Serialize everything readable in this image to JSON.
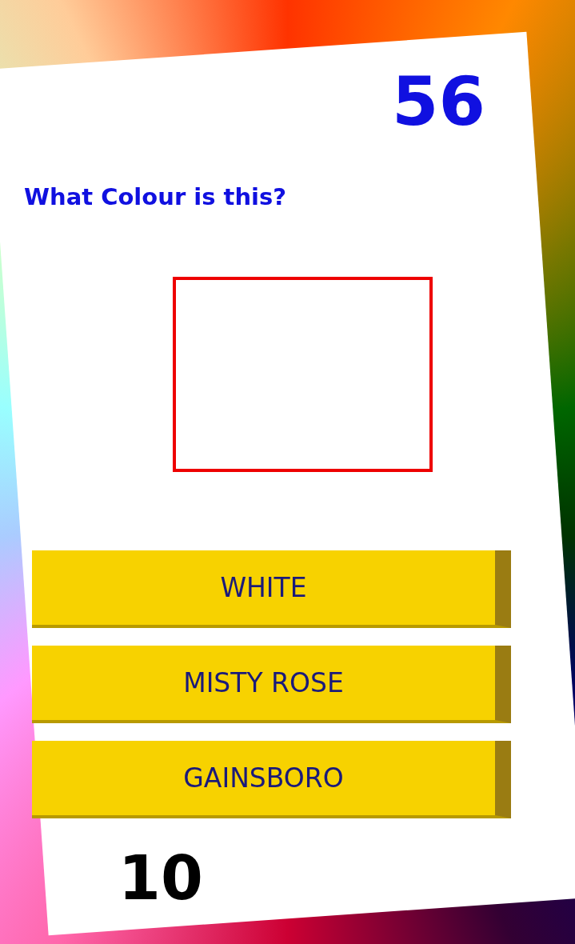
{
  "score": "56",
  "question": "What Colour is this?",
  "swatch": {
    "color": "#ffffff"
  },
  "answers": [
    {
      "label": "WHITE"
    },
    {
      "label": "MISTY ROSE"
    },
    {
      "label": "GAINSBORO"
    }
  ],
  "counter": "10"
}
